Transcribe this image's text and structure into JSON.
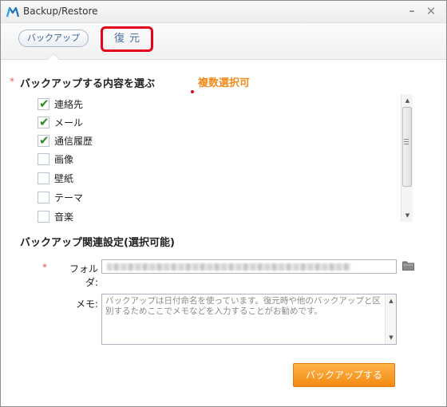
{
  "window": {
    "title": "Backup/Restore",
    "minimize_label": "–",
    "close_label": "✕"
  },
  "tabs": {
    "backup_label": "バックアップ",
    "restore_label": "復元"
  },
  "content_section": {
    "required_mark": "*",
    "title": "バックアップする内容を選ぶ",
    "multi_select_note": "複数選択可",
    "items": [
      {
        "label": "連絡先",
        "checked": true
      },
      {
        "label": "メール",
        "checked": true
      },
      {
        "label": "通信履歴",
        "checked": true
      },
      {
        "label": "画像",
        "checked": false
      },
      {
        "label": "壁紙",
        "checked": false
      },
      {
        "label": "テーマ",
        "checked": false
      },
      {
        "label": "音楽",
        "checked": false
      }
    ]
  },
  "settings_section": {
    "title": "バックアップ関連設定(選択可能)",
    "required_mark": "*",
    "folder_label": "フォルダ:",
    "memo_label": "メモ:",
    "memo_placeholder": "バックアップは日付命名を使っています。復元時や他のバックアップと区別するためここでメモなどを入力することがお勧めです。"
  },
  "actions": {
    "backup_button_label": "バックアップする"
  },
  "colors": {
    "accent_orange": "#f28a12",
    "note_orange": "#f08a1c",
    "highlight_red": "#e3001b",
    "check_green": "#2e8b22"
  }
}
